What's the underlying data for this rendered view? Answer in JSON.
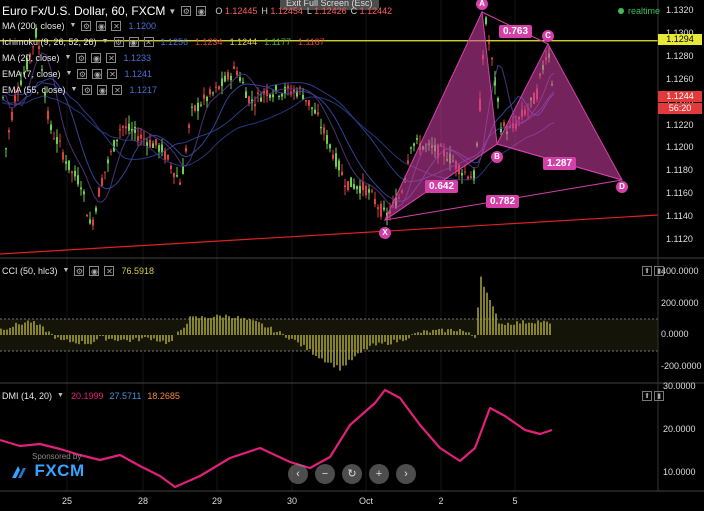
{
  "header": {
    "symbol": "Euro Fx/U.S. Dollar, 60, FXCM",
    "ohlc": [
      {
        "k": "O",
        "v": "1.12445"
      },
      {
        "k": "H",
        "v": "1.12454"
      },
      {
        "k": "L",
        "v": "1.12426"
      },
      {
        "k": "C",
        "v": "1.12442"
      }
    ],
    "realtime": "realtime",
    "exit_fullscreen": "Exit Full Screen (Esc)"
  },
  "indicators": [
    {
      "name": "MA (200, close)",
      "values": [
        "1.1200"
      ],
      "colors": [
        "#4b6fd6"
      ]
    },
    {
      "name": "Ichimoku (9, 26, 52, 26)",
      "values": [
        "1.1256",
        "1.1234",
        "1.1244",
        "1.1177",
        "1.1187"
      ],
      "colors": [
        "#4b6fd6",
        "#e0404a",
        "#d7d04a",
        "#4bb04a",
        "#e0404a"
      ]
    },
    {
      "name": "MA (20, close)",
      "values": [
        "1.1233"
      ],
      "colors": [
        "#4b6fd6"
      ]
    },
    {
      "name": "EMA (7, close)",
      "values": [
        "1.1241"
      ],
      "colors": [
        "#4b6fd6"
      ]
    },
    {
      "name": "EMA (55, close)",
      "values": [
        "1.1217"
      ],
      "colors": [
        "#4b6fd6"
      ]
    }
  ],
  "price_axis": {
    "ticks": [
      "1.1320",
      "1.1300",
      "1.1280",
      "1.1260",
      "1.1240",
      "1.1220",
      "1.1200",
      "1.1180",
      "1.1160",
      "1.1140",
      "1.1120"
    ],
    "tags": [
      {
        "text": "1.1294",
        "bg": "#e8e83a",
        "fg": "#000"
      },
      {
        "text": "1.1244",
        "bg": "#e23a3a",
        "fg": "#fff"
      },
      {
        "text": "56:20",
        "bg": "#e23a3a",
        "fg": "#fff"
      }
    ]
  },
  "pattern": {
    "points": [
      "X",
      "A",
      "B",
      "C",
      "D"
    ],
    "ratios": [
      "0.763",
      "0.642",
      "1.287",
      "0.782"
    ],
    "color": "#d440a8"
  },
  "cci": {
    "label": "CCI (50, hlc3)",
    "value": "76.5918",
    "value_color": "#d7d04a",
    "ticks": [
      "400.0000",
      "200.0000",
      "0.0000",
      "-200.0000"
    ]
  },
  "dmi": {
    "label": "DMI (14, 20)",
    "values": [
      "20.1999",
      "27.5711",
      "18.2685"
    ],
    "colors": [
      "#e0207a",
      "#4b8fd6",
      "#f08a30"
    ],
    "ticks": [
      "30.0000",
      "20.0000",
      "10.0000"
    ]
  },
  "x_axis": {
    "labels": [
      "25",
      "28",
      "29",
      "30",
      "Oct",
      "2",
      "5"
    ]
  },
  "nav": {
    "buttons": [
      {
        "label": "‹",
        "name": "scroll-left-button"
      },
      {
        "label": "−",
        "name": "zoom-out-button"
      },
      {
        "label": "↻",
        "name": "reset-button"
      },
      {
        "label": "+",
        "name": "zoom-in-button"
      },
      {
        "label": "›",
        "name": "scroll-right-button"
      }
    ]
  },
  "logo": {
    "sponsored": "Sponsored by",
    "brand": "FXCM"
  }
}
